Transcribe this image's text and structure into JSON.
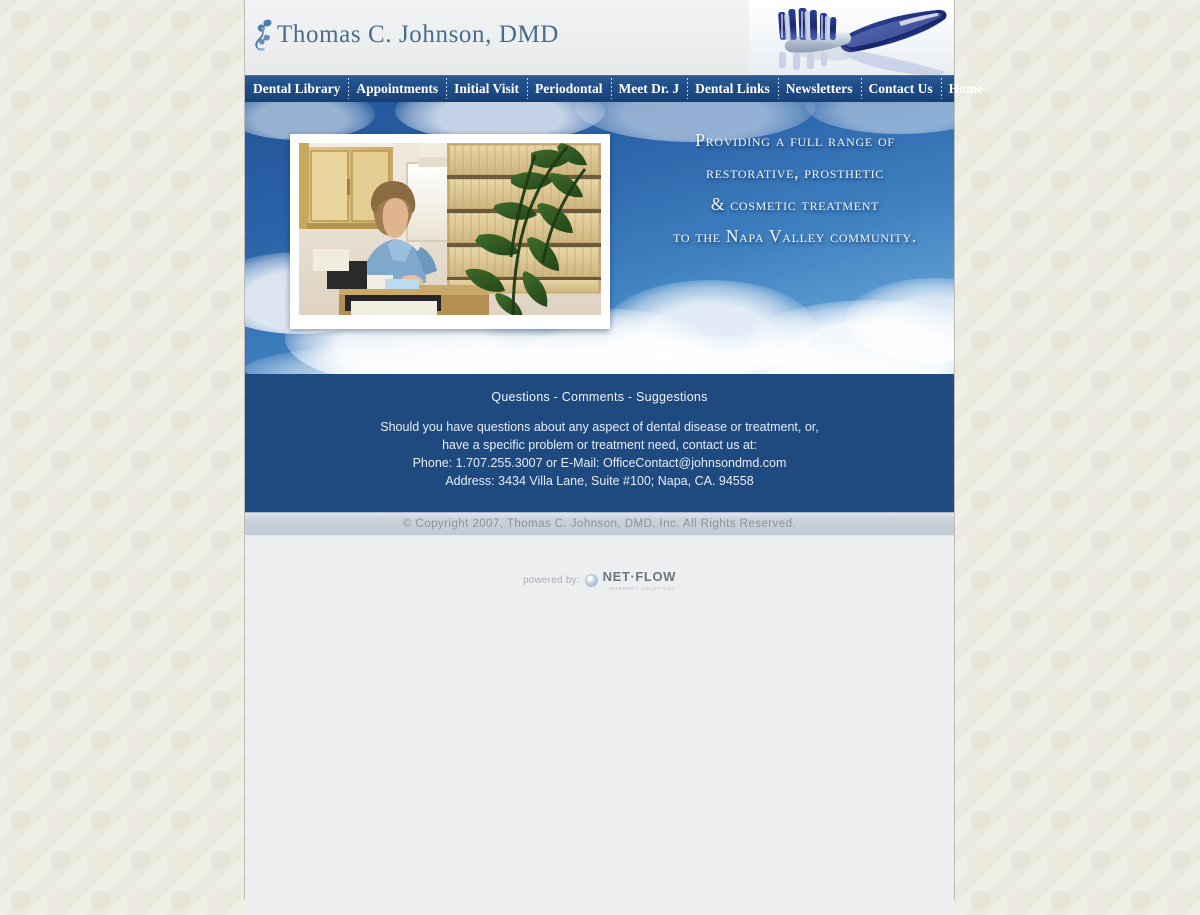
{
  "site": {
    "header": {
      "practice_name": "Thomas C. Johnson, DMD",
      "ornament_icon": "floral-ornament-icon",
      "hero_brush_icon": "toothbrush-photo"
    },
    "nav": {
      "items": [
        {
          "label": "Dental Library",
          "name": "dental-library"
        },
        {
          "label": "Appointments",
          "name": "appointments"
        },
        {
          "label": "Initial Visit",
          "name": "initial-visit"
        },
        {
          "label": "Periodontal",
          "name": "periodontal"
        },
        {
          "label": "Meet Dr. J",
          "name": "meet-dr-j"
        },
        {
          "label": "Dental Links",
          "name": "dental-links"
        },
        {
          "label": "Newsletters",
          "name": "newsletters"
        },
        {
          "label": "Contact Us",
          "name": "contact-us"
        },
        {
          "label": "Home",
          "name": "home"
        }
      ]
    },
    "hero": {
      "photo_alt": "dental office receptionist at front desk with file folders and plant",
      "tagline_lines": [
        "Providing a full range of",
        "restorative, prosthetic",
        "& cosmetic treatment",
        "to the Napa Valley community."
      ]
    },
    "contact": {
      "heading": "Questions - Comments - Suggestions",
      "line1": "Should you have questions about any aspect of dental disease or treatment, or,",
      "line2": "have a specific problem or treatment need, contact us at:",
      "phone_label": "Phone: 1.707.255.3007 or E-Mail: ",
      "email": "OfficeContact@johnsondmd.com",
      "address": "Address: 3434 Villa Lane, Suite #100; Napa, CA. 94558"
    },
    "copyright": {
      "text": "© Copyright 2007, Thomas C. Johnson, DMD, Inc. All Rights Reserved."
    },
    "footer": {
      "powered_label": "powered by:",
      "brand_mark_icon": "netflow-globe-icon",
      "brand_name": "NET·FLOW",
      "brand_tagline": "INTERNET SOLUTIONS"
    },
    "colors": {
      "nav_blue": "#1f4a80",
      "panel_blue": "#1f4a80",
      "header_bg": "#eceef0",
      "copyright_bg": "#c2cad5",
      "title_blue": "#4a6b90",
      "page_bg": "#f0efe7"
    }
  }
}
